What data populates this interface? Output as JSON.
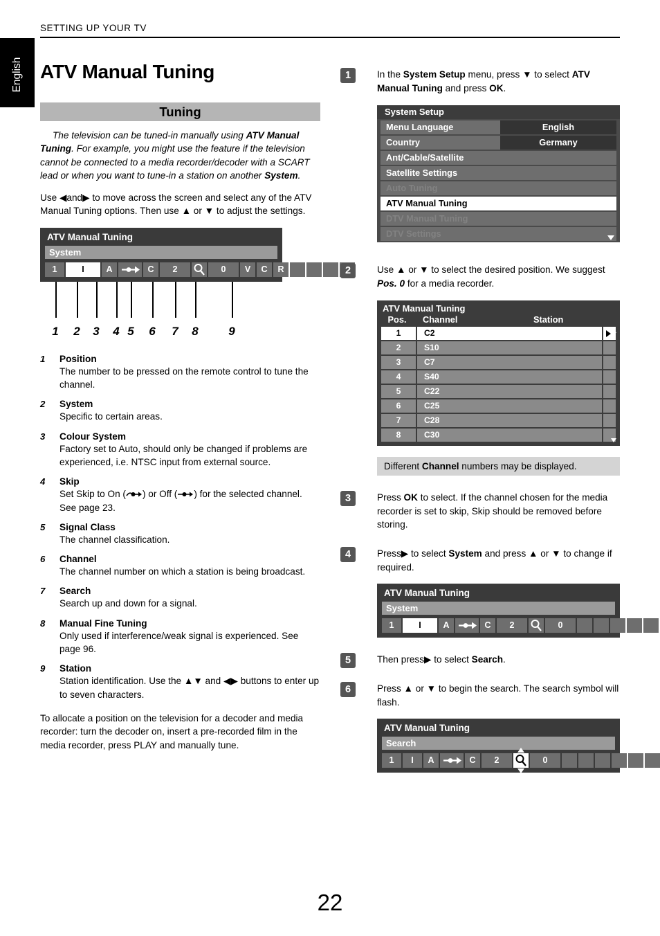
{
  "header": {
    "running_head": "SETTING UP YOUR TV",
    "language_tab": "English"
  },
  "page_number": "22",
  "left": {
    "title": "ATV Manual Tuning",
    "section_bar": "Tuning",
    "intro_parts": {
      "p1a": "The television can be tuned-in manually using ",
      "p1b": "ATV Manual Tuning",
      "p1c": ". For example, you might use the feature if the television cannot be connected to a media recorder/decoder with a SCART lead or when you want to tune-in a station on another ",
      "p1d": "System",
      "p1e": "."
    },
    "para2_parts": {
      "a": "Use ",
      "left_arrow": "◀",
      "b": "and",
      "right_arrow": "▶",
      "c": " to move across the screen and select any of the ATV Manual Tuning options. Then use ",
      "up_arrow": "▲",
      "d": " or ",
      "down_arrow": "▼",
      "e": " to adjust the settings."
    },
    "diagram": {
      "panel_title": "ATV Manual Tuning",
      "panel_sub": "System",
      "cells": [
        "1",
        "I",
        "A",
        "skip-arrow",
        "C",
        "2",
        "search-glass",
        "0",
        "V",
        "C",
        "R",
        "",
        "",
        "",
        ""
      ],
      "callout_numbers": [
        "1",
        "2",
        "3",
        "4",
        "5",
        "6",
        "7",
        "8",
        "9"
      ]
    },
    "definitions": [
      {
        "num": "1",
        "term": "Position",
        "body": "The number to be pressed on the remote control to tune the channel."
      },
      {
        "num": "2",
        "term": "System",
        "body": "Specific to certain areas."
      },
      {
        "num": "3",
        "term": "Colour System",
        "body": "Factory set to Auto, should only be changed if problems are experienced, i.e. NTSC input from external source."
      },
      {
        "num": "4",
        "term": "Skip",
        "body_a": "Set Skip to On (",
        "body_on_icon": "skip-on-icon",
        "body_b": ") or Off (",
        "body_off_icon": "skip-off-icon",
        "body_c": ") for the selected channel. See page 23."
      },
      {
        "num": "5",
        "term": "Signal Class",
        "body": "The channel classification."
      },
      {
        "num": "6",
        "term": "Channel",
        "body": "The channel number on which a station is being broadcast."
      },
      {
        "num": "7",
        "term": "Search",
        "body": "Search up and down for a signal."
      },
      {
        "num": "8",
        "term": "Manual Fine Tuning",
        "body": "Only used if interference/weak signal is experienced. See page 96."
      },
      {
        "num": "9",
        "term": "Station",
        "body_a": "Station identification. Use the ",
        "body_arrows1": "▲▼",
        "body_b": " and ",
        "body_arrows2": "◀▶",
        "body_c": " buttons to enter up to seven characters."
      }
    ],
    "closing": "To allocate a position on the television for a decoder and media recorder: turn the decoder on, insert a pre-recorded film in the media recorder, press PLAY and manually tune."
  },
  "right": {
    "steps": [
      {
        "badge": "1",
        "parts": {
          "a": "In the ",
          "b": "System Setup",
          "c": " menu, press ",
          "arrow": "▼",
          "d": " to select ",
          "e": "ATV Manual Tuning",
          "f": " and press ",
          "g": "OK",
          "h": "."
        }
      },
      {
        "badge": "2",
        "parts": {
          "a": "Use ",
          "up": "▲",
          "b": " or ",
          "down": "▼",
          "c": " to select the desired position. We suggest ",
          "d": "Pos. 0",
          "e": " for a media recorder."
        }
      },
      {
        "badge": "3",
        "parts": {
          "a": "Press ",
          "b": "OK",
          "c": " to select. If the channel chosen for the media recorder is set to skip, Skip should be removed before storing."
        }
      },
      {
        "badge": "4",
        "parts": {
          "a": "Press",
          "right": "▶",
          "b": " to select ",
          "c": "System",
          "d": " and press ",
          "up": "▲",
          "e": " or ",
          "down": "▼",
          "f": " to change if required."
        }
      },
      {
        "badge": "5",
        "parts": {
          "a": "Then press",
          "right": "▶",
          "b": " to select ",
          "c": "Search",
          "d": "."
        }
      },
      {
        "badge": "6",
        "parts": {
          "a": "Press ",
          "up": "▲",
          "b": " or ",
          "down": "▼",
          "c": " to begin the search. The search symbol will flash."
        }
      }
    ],
    "system_setup": {
      "title": "System Setup",
      "rows": [
        {
          "label": "Menu Language",
          "value": "English",
          "state": "normal"
        },
        {
          "label": "Country",
          "value": "Germany",
          "state": "normal"
        },
        {
          "label": "Ant/Cable/Satellite",
          "value": "",
          "state": "normal"
        },
        {
          "label": "Satellite Settings",
          "value": "",
          "state": "normal"
        },
        {
          "label": "Auto Tuning",
          "value": "",
          "state": "dim"
        },
        {
          "label": "ATV Manual Tuning",
          "value": "",
          "state": "selected"
        },
        {
          "label": "DTV Manual Tuning",
          "value": "",
          "state": "dim"
        },
        {
          "label": "DTV Settings",
          "value": "",
          "state": "dim"
        }
      ]
    },
    "channel_table": {
      "title": "ATV Manual Tuning",
      "columns": [
        "Pos.",
        "Channel",
        "Station"
      ],
      "rows": [
        {
          "pos": "1",
          "channel": "C2",
          "station": "",
          "selected": true
        },
        {
          "pos": "2",
          "channel": "S10",
          "station": "",
          "selected": false
        },
        {
          "pos": "3",
          "channel": "C7",
          "station": "",
          "selected": false
        },
        {
          "pos": "4",
          "channel": "S40",
          "station": "",
          "selected": false
        },
        {
          "pos": "5",
          "channel": "C22",
          "station": "",
          "selected": false
        },
        {
          "pos": "6",
          "channel": "C25",
          "station": "",
          "selected": false
        },
        {
          "pos": "7",
          "channel": "C28",
          "station": "",
          "selected": false
        },
        {
          "pos": "8",
          "channel": "C30",
          "station": "",
          "selected": false
        }
      ]
    },
    "note_parts": {
      "a": "Different ",
      "b": "Channel",
      "c": " numbers may be displayed."
    },
    "panel_system": {
      "panel_title": "ATV Manual Tuning",
      "panel_sub": "System",
      "cells": [
        "1",
        "I",
        "A",
        "skip-arrow",
        "C",
        "2",
        "search-glass",
        "0",
        "",
        "",
        "",
        "",
        "",
        "",
        ""
      ]
    },
    "panel_search": {
      "panel_title": "ATV Manual Tuning",
      "panel_sub": "Search",
      "cells": [
        "1",
        "I",
        "A",
        "skip-arrow",
        "C",
        "2",
        "search-glass",
        "0",
        "",
        "",
        "",
        "",
        "",
        "",
        ""
      ]
    }
  },
  "colors": {
    "osd_bg": "#3a3a3a",
    "osd_sub": "#9a9a9a",
    "cell": "#6e6e6e",
    "note_bg": "#d4d4d4",
    "section_bar": "#b5b5b5"
  }
}
